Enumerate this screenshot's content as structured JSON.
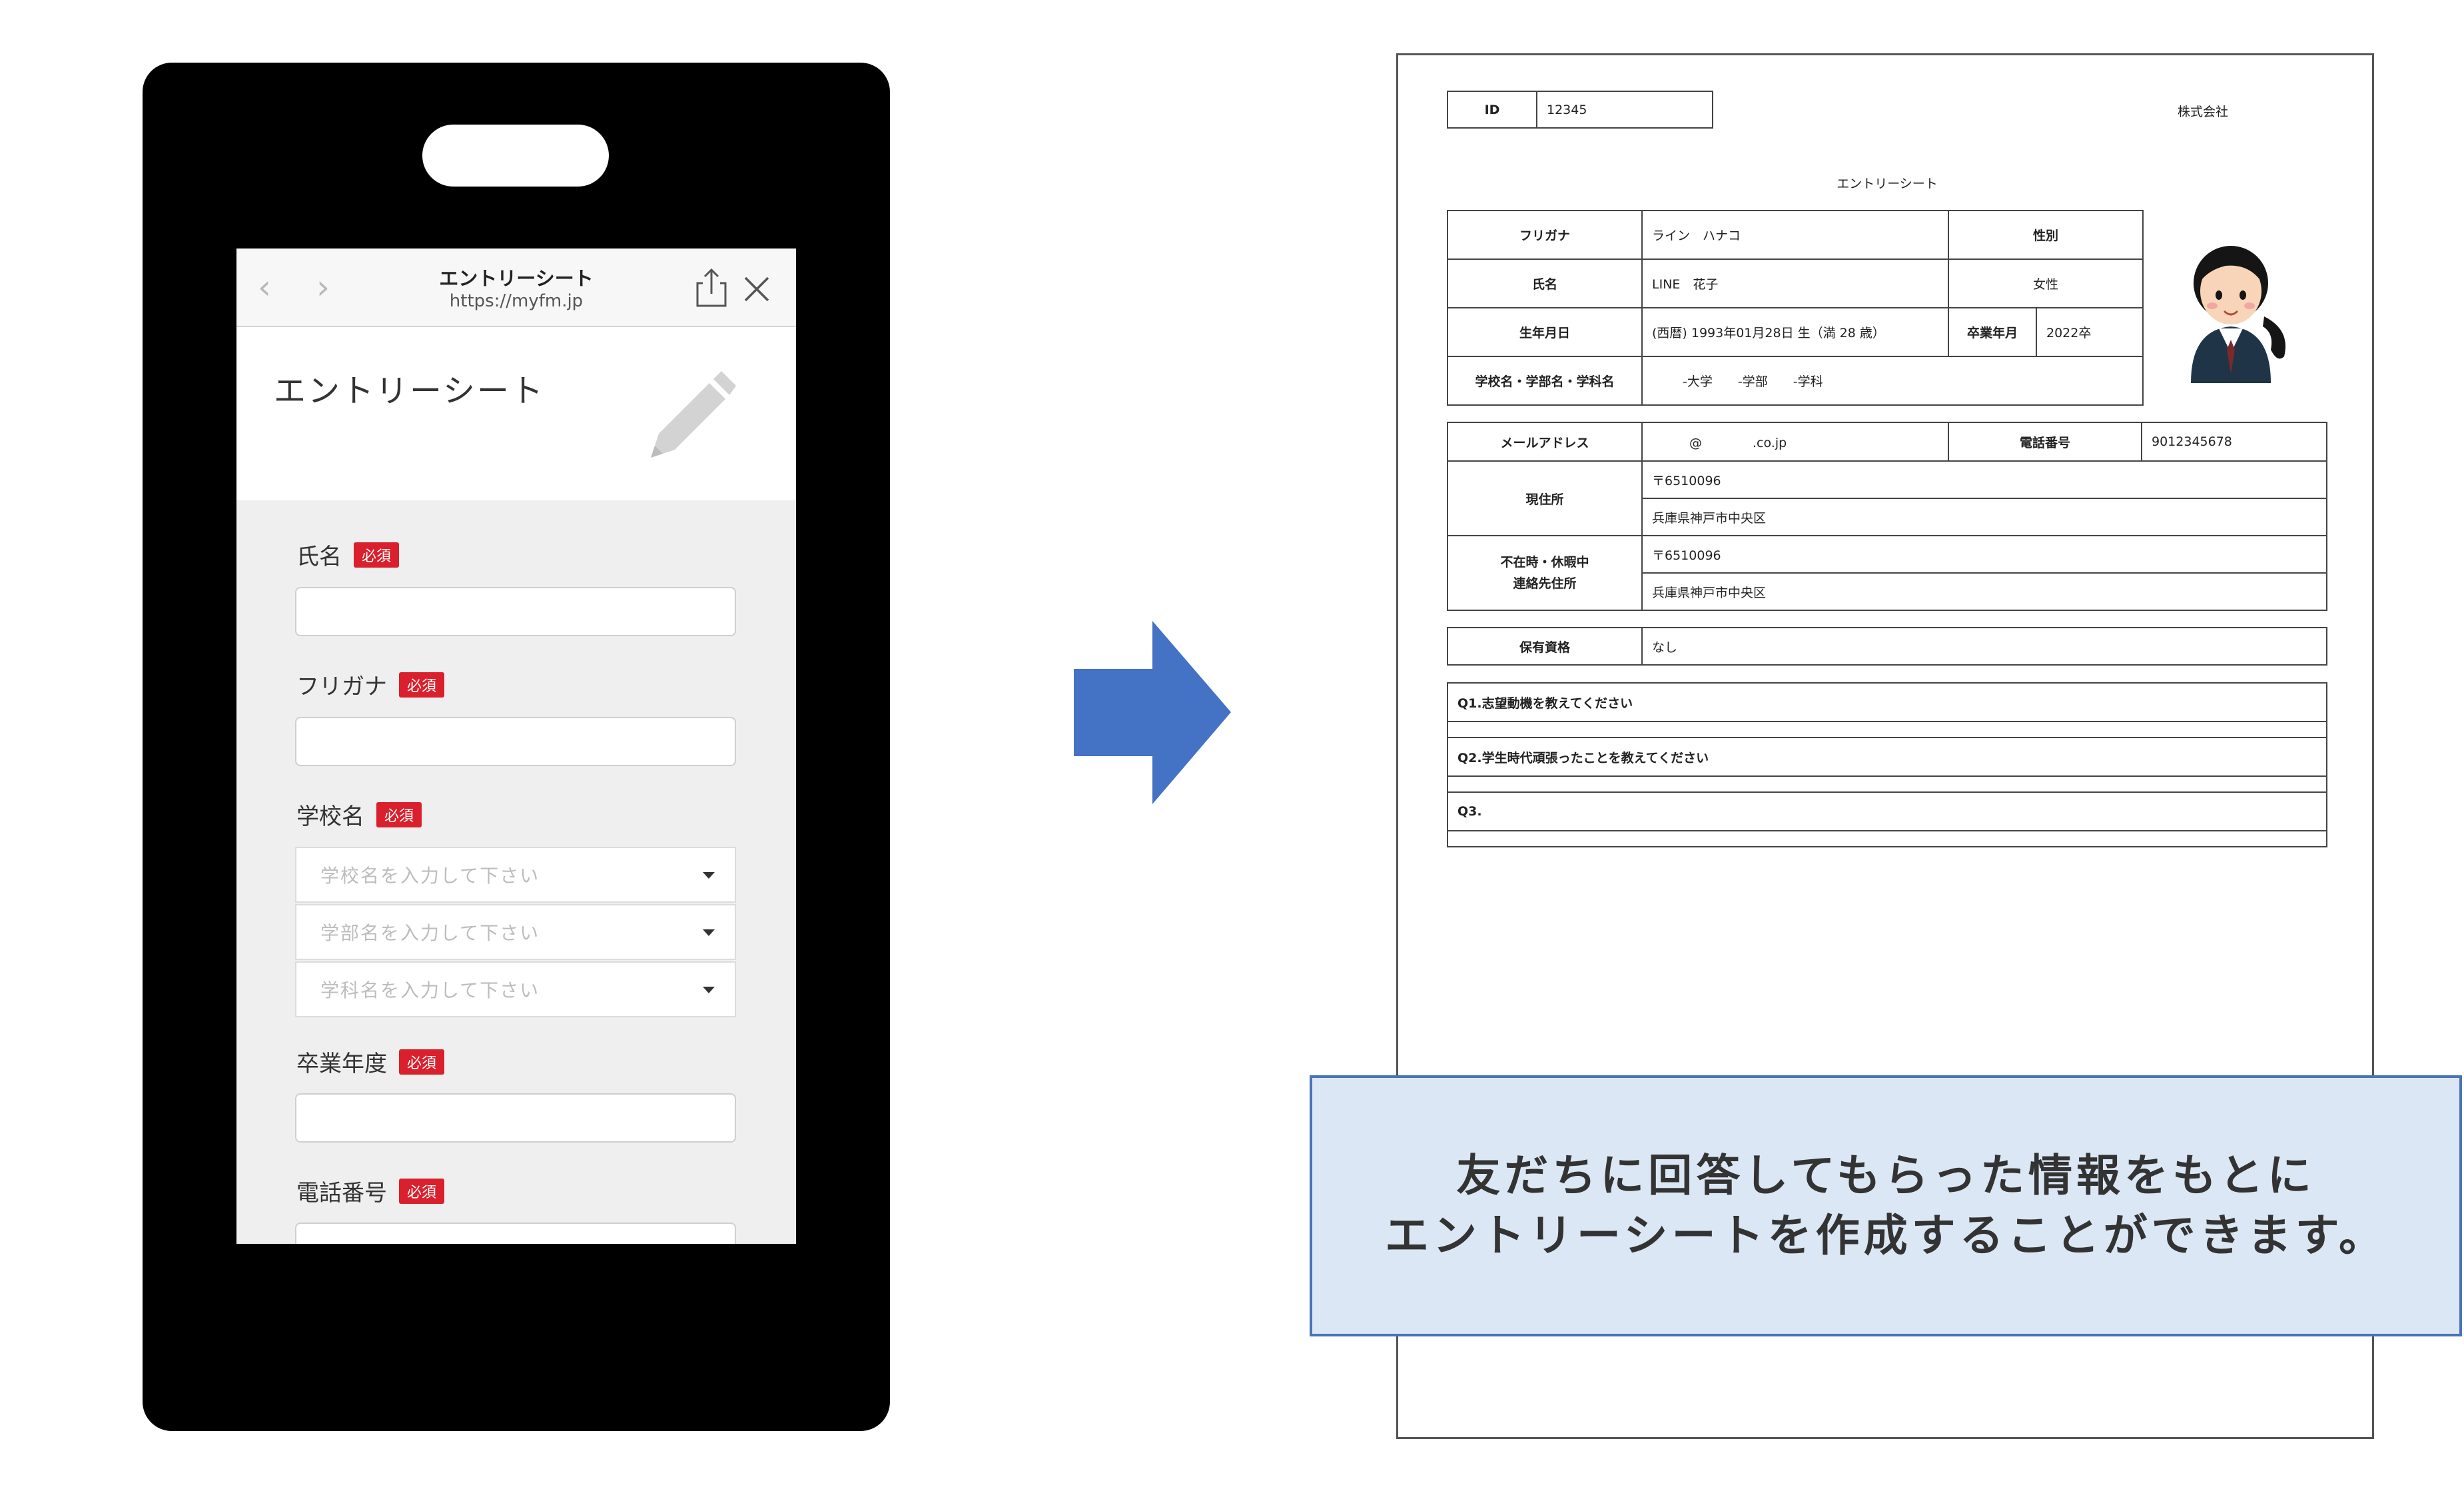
{
  "phone": {
    "browser": {
      "title": "エントリーシート",
      "url": "https://myfm.jp",
      "back_icon": "chevron-left-icon",
      "forward_icon": "chevron-right-icon",
      "share_icon": "share-icon",
      "close_icon": "close-icon"
    },
    "page_title": "エントリーシート",
    "required_label": "必須",
    "fields": [
      {
        "label": "氏名",
        "type": "text"
      },
      {
        "label": "フリガナ",
        "type": "text"
      },
      {
        "label": "学校名",
        "type": "select"
      },
      {
        "label": "卒業年度",
        "type": "text"
      },
      {
        "label": "電話番号",
        "type": "text"
      }
    ],
    "school_selects": [
      "学校名を入力して下さい",
      "学部名を入力して下さい",
      "学科名を入力して下さい"
    ]
  },
  "arrow_color": "#4472c4",
  "document": {
    "id_label": "ID",
    "id_value": "12345",
    "company": "株式会社",
    "title": "エントリーシート",
    "profile": {
      "furigana_label": "フリガナ",
      "furigana_value": "ライン　ハナコ",
      "gender_label": "性別",
      "name_label": "氏名",
      "name_value": "LINE　花子",
      "gender_value": "女性",
      "birth_label": "生年月日",
      "birth_value": "(西暦) 1993年01月28日 生（満 28 歳）",
      "grad_label": "卒業年月",
      "grad_value": "2022卒",
      "school_label": "学校名・学部名・学科名",
      "school_value": "-大学　　-学部　　-学科"
    },
    "contact": {
      "email_label": "メールアドレス",
      "email_value": "@　　　　.co.jp",
      "phone_label": "電話番号",
      "phone_value": "9012345678",
      "address_label": "現住所",
      "address_zip": "〒6510096",
      "address_value": "兵庫県神戸市中央区",
      "alt_label_1": "不在時・休暇中",
      "alt_label_2": "連絡先住所",
      "alt_zip": "〒6510096",
      "alt_value": "兵庫県神戸市中央区"
    },
    "qualification_label": "保有資格",
    "qualification_value": "なし",
    "questions": [
      "Q1.志望動機を教えてください",
      "Q2.学生時代頑張ったことを教えてください",
      "Q3."
    ]
  },
  "callout": {
    "line1": "友だちに回答してもらった情報をもとに",
    "line2": "エントリーシートを作成することができます。"
  }
}
